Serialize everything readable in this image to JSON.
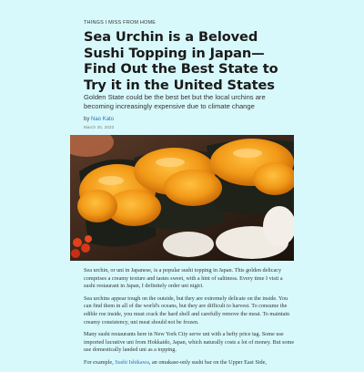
{
  "article": {
    "category": "Things I Miss From Home",
    "title": "Sea Urchin is a Beloved Sushi Topping in Japan—Find Out the Best State to Try it in the United States",
    "subtitle": "Golden State could be the best bet but the local urchins are becoming increasingly expensive due to climate change",
    "byline_prefix": "by",
    "author": "Nao Kato",
    "date": "March 20, 2023",
    "hero_image": "sea-urchin-sushi-photo",
    "paragraphs": [
      "Sea urchin, or uni in Japanese, is a popular sushi topping in Japan. This golden delicacy comprises a creamy texture and tastes sweet, with a hint of saltiness. Every time I visit a sushi restaurant in Japan, I definitely order uni nigiri.",
      "Sea urchins appear tough on the outside, but they are extremely delicate on the inside. You can find them in all of the world's oceans, but they are difficult to harvest. To consume the edible roe inside, you must crack the hard shell and carefully remove the meat. To maintain creamy consistency, uni meat should not be frozen.",
      "Many sushi restaurants here in New York City serve uni with a hefty price tag. Some use imported lucrative uni from Hokkaido, Japan, which naturally costs a lot of money. But some use domestically landed uni as a topping."
    ],
    "last_paragraph_prefix": "For example,",
    "last_paragraph_link": "Sushi Ishikawa",
    "last_paragraph_suffix": ", an omakase-only sushi bar on the Upper East Side,"
  },
  "colors": {
    "background": "#d8f9fb",
    "link": "#2a6fc0",
    "uni": "#f2a11f"
  }
}
